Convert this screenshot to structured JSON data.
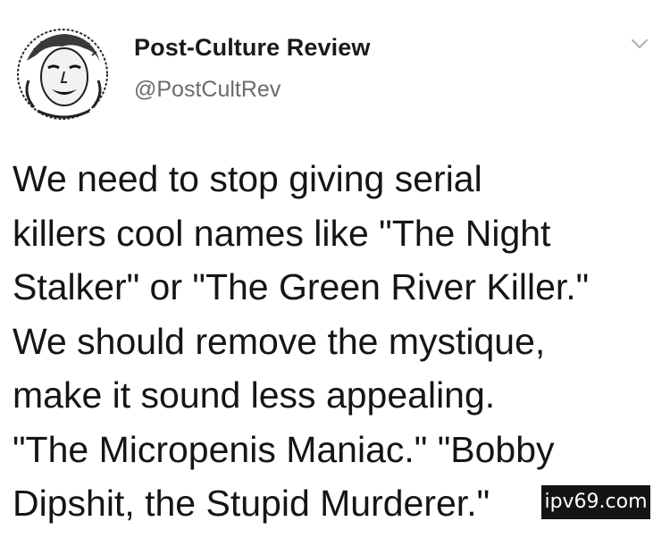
{
  "account": {
    "display_name": "Post-Culture Review",
    "handle": "@PostCultRev"
  },
  "menu": {
    "icon": "chevron-down-icon"
  },
  "tweet": {
    "lines": [
      "We need to stop giving serial",
      "killers cool names like \"The Night",
      "Stalker\" or \"The Green River Killer.\"",
      "We should remove the mystique,",
      "make it sound less appealing.",
      "\"The Micropenis Maniac.\" \"Bobby",
      "Dipshit, the Stupid Murderer.\""
    ]
  },
  "watermark": {
    "text": "ipv69.com"
  }
}
